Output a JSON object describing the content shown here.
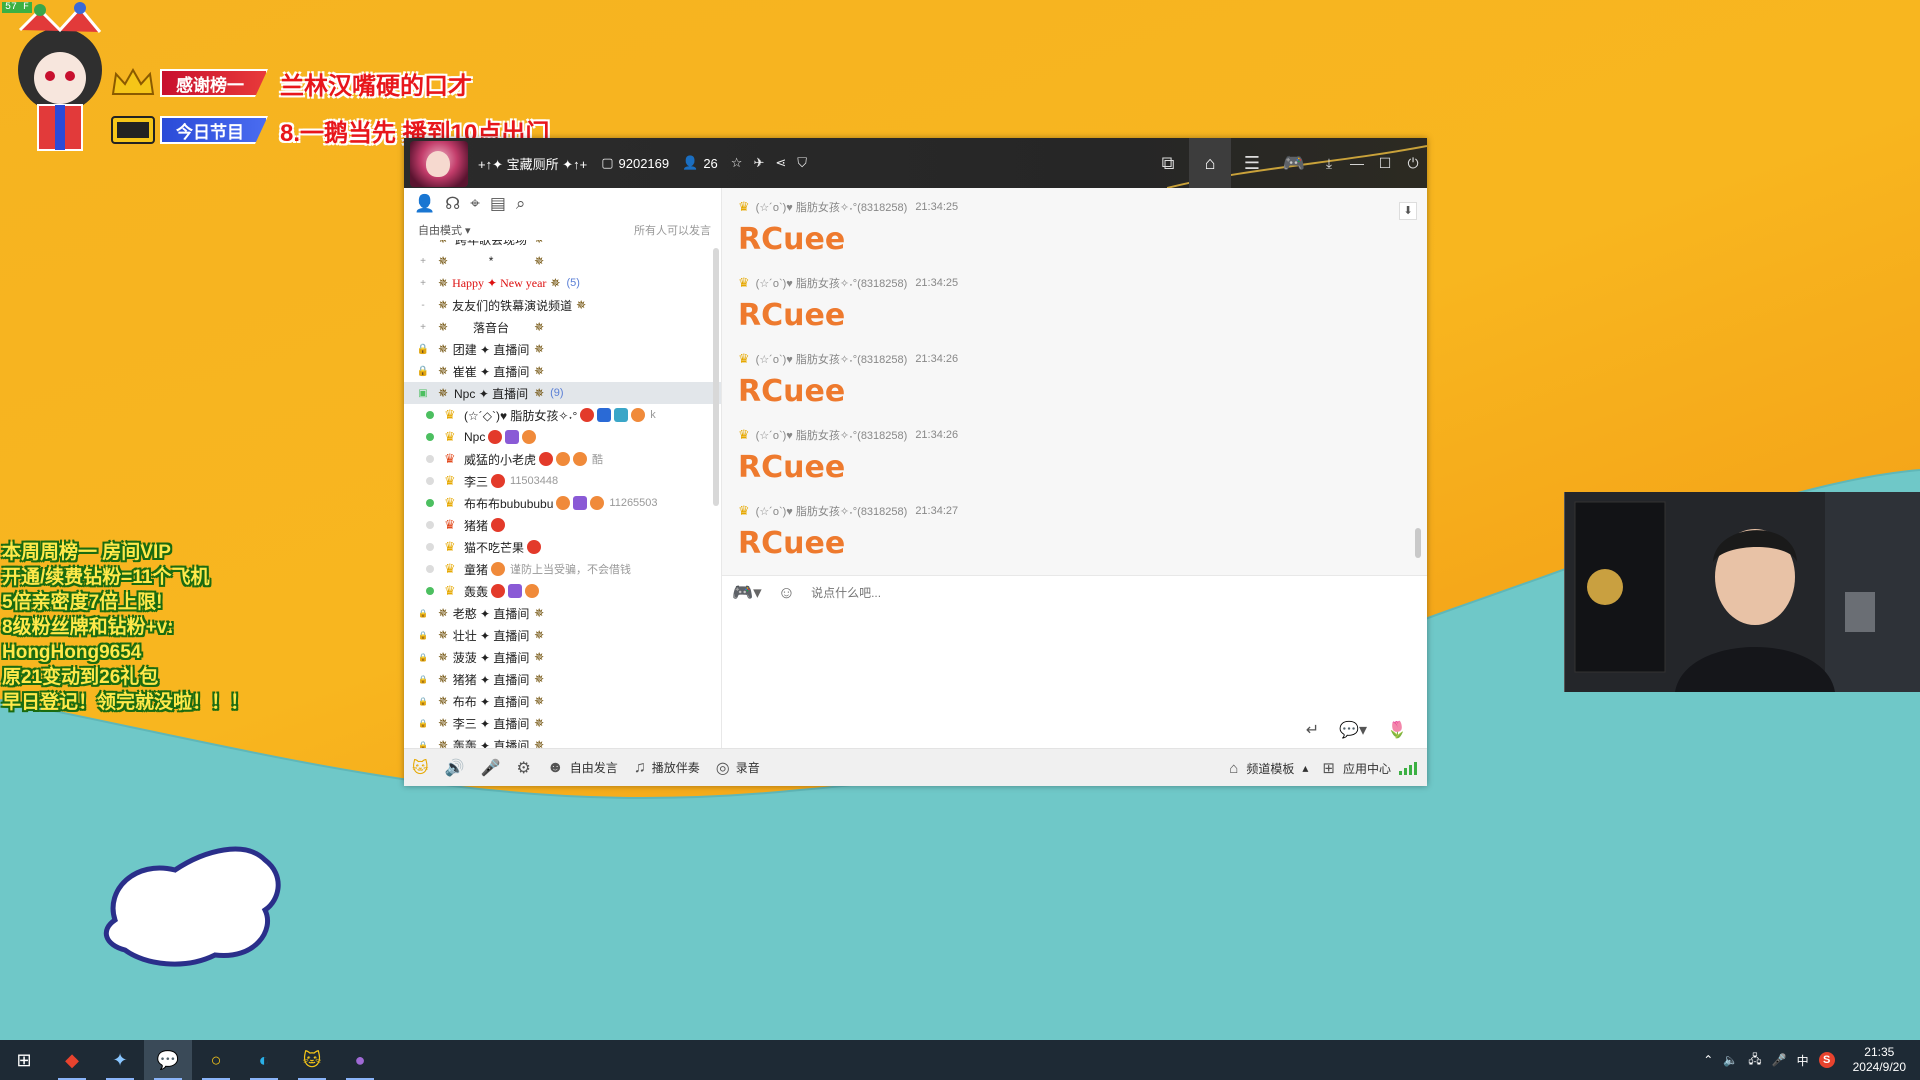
{
  "overlay": {
    "fps": "57 F",
    "thanks_tag": "感谢榜一",
    "thanks_name": "兰林汉嘴硬的口才",
    "program_tag": "今日节目",
    "program_text": "8.一鹅当先 播到10点出门",
    "weekly": [
      "本周周榜一 房间VIP",
      "开通/续费钻粉=11个飞机",
      "5倍亲密度7倍上限!",
      "8级粉丝牌和钻粉+v:",
      "HongHong9654",
      "原21变动到26礼包",
      "早日登记！领完就没啦！！！"
    ]
  },
  "window": {
    "channel_name": "+↑✦ 宝藏厕所 ✦↑+",
    "channel_id": "9202169",
    "online_count": "26",
    "title_icons": [
      "star-icon",
      "plane-icon",
      "share-icon",
      "shield-icon"
    ],
    "title_buttons": [
      "live-video-icon",
      "home-icon",
      "list-icon",
      "gamepad-icon",
      "download-icon",
      "minimize-icon",
      "maximize-icon",
      "power-icon"
    ]
  },
  "left": {
    "mode": "自由模式",
    "permission": "所有人可以发言",
    "channels_top": [
      {
        "lead": "▪",
        "name": "跨年歌会现场",
        "count": ""
      },
      {
        "lead": "+",
        "name": "*",
        "count": ""
      },
      {
        "lead": "+",
        "name": "Happy ✦ New year",
        "count": "(5)",
        "red": true
      },
      {
        "lead": "-",
        "name": "友友们的铁幕演说频道",
        "count": ""
      },
      {
        "lead": "+",
        "name": "落音台",
        "count": ""
      },
      {
        "lead": "🔒",
        "name": "团建 ✦ 直播间",
        "count": ""
      },
      {
        "lead": "🔒",
        "name": "崔崔 ✦ 直播间",
        "count": ""
      },
      {
        "lead": "▣",
        "name": "Npc ✦ 直播间",
        "count": "(9)",
        "selected": true
      }
    ],
    "users": [
      {
        "online": true,
        "name": "(☆´◇`)♥ 脂肪女孩✧˖°",
        "sub": "k",
        "badges": [
          "red",
          "blue",
          "teal",
          "orange"
        ]
      },
      {
        "online": true,
        "name": "Npc",
        "sub": "",
        "badges": [
          "red",
          "purple",
          "orange"
        ]
      },
      {
        "online": false,
        "name": "威猛的小老虎",
        "sub": "酷",
        "badges": [
          "red",
          "orange",
          "orange"
        ],
        "roleRed": true
      },
      {
        "online": false,
        "name": "李三",
        "sub": "11503448",
        "badges": [
          "red"
        ]
      },
      {
        "online": true,
        "name": "布布布bubububu",
        "sub": "11265503",
        "badges": [
          "orange",
          "purple",
          "orange"
        ]
      },
      {
        "online": false,
        "name": "猪猪",
        "sub": "",
        "badges": [
          "red"
        ],
        "roleRed": true
      },
      {
        "online": false,
        "name": "猫不吃芒果",
        "sub": "",
        "badges": [
          "red"
        ]
      },
      {
        "online": false,
        "name": "童猪",
        "sub": "谨防上当受骗，不会借钱",
        "badges": [
          "orange"
        ]
      },
      {
        "online": true,
        "name": "轰轰",
        "sub": "",
        "badges": [
          "red",
          "purple",
          "orange"
        ]
      }
    ],
    "channels_bottom": [
      {
        "name": "老憨 ✦ 直播间"
      },
      {
        "name": "壮壮 ✦ 直播间"
      },
      {
        "name": "菠菠 ✦ 直播间"
      },
      {
        "name": "猪猪 ✦ 直播间"
      },
      {
        "name": "布布 ✦ 直播间"
      },
      {
        "name": "李三 ✦ 直播间"
      },
      {
        "name": "轰轰 ✦ 直播间"
      }
    ]
  },
  "chat": {
    "messages": [
      {
        "sender": "(☆´o`)♥ 脂肪女孩✧˖°(8318258)",
        "time": "21:34:25",
        "text": "RCuee"
      },
      {
        "sender": "(☆´o`)♥ 脂肪女孩✧˖°(8318258)",
        "time": "21:34:25",
        "text": "RCuee"
      },
      {
        "sender": "(☆´o`)♥ 脂肪女孩✧˖°(8318258)",
        "time": "21:34:26",
        "text": "RCuee"
      },
      {
        "sender": "(☆´o`)♥ 脂肪女孩✧˖°(8318258)",
        "time": "21:34:26",
        "text": "RCuee"
      },
      {
        "sender": "(☆´o`)♥ 脂肪女孩✧˖°(8318258)",
        "time": "21:34:27",
        "text": "RCuee"
      }
    ],
    "input_placeholder": "说点什么吧..."
  },
  "statusbar": {
    "free_speak": "自由发言",
    "play_music": "播放伴奏",
    "record": "录音",
    "channel_template": "频道模板",
    "app_center": "应用中心"
  },
  "taskbar": {
    "time": "21:35",
    "date": "2024/9/20",
    "ime": "中",
    "apps": [
      "windows-start-icon",
      "app-red-icon",
      "app-dark-icon",
      "wechat-icon",
      "app-ring-icon",
      "edge-icon",
      "yy-icon",
      "app-purple-icon"
    ]
  },
  "colors": {
    "chat_text": "#ee7a2e",
    "title_bar": "#262626",
    "background_orange": "#f6b321",
    "background_teal": "#6fc8c8"
  }
}
